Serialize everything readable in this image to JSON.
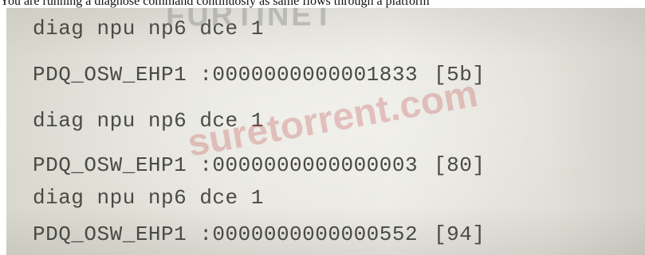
{
  "caption": "You are running a diagnose command continuosly as same flows through a platform",
  "terminal": {
    "lines": [
      {
        "text": "diag npu np6 dce 1"
      },
      {
        "text": "PDQ_OSW_EHP1 :0000000000001833",
        "code": "[5b]"
      },
      {
        "text": "diag npu np6 dce 1"
      },
      {
        "text": "PDQ_OSW_EHP1 :0000000000000003",
        "code": "[80]"
      },
      {
        "text": "diag npu np6 dce 1"
      },
      {
        "text": "PDQ_OSW_EHP1 :0000000000000552",
        "code": "[94]"
      }
    ]
  },
  "overlays": {
    "logo": "FURTINET",
    "watermark": "suretorrent.com"
  },
  "colors": {
    "terminal_text": "#4a4a44",
    "watermark": "#be4646",
    "screen_background": "#e6e5dd"
  }
}
